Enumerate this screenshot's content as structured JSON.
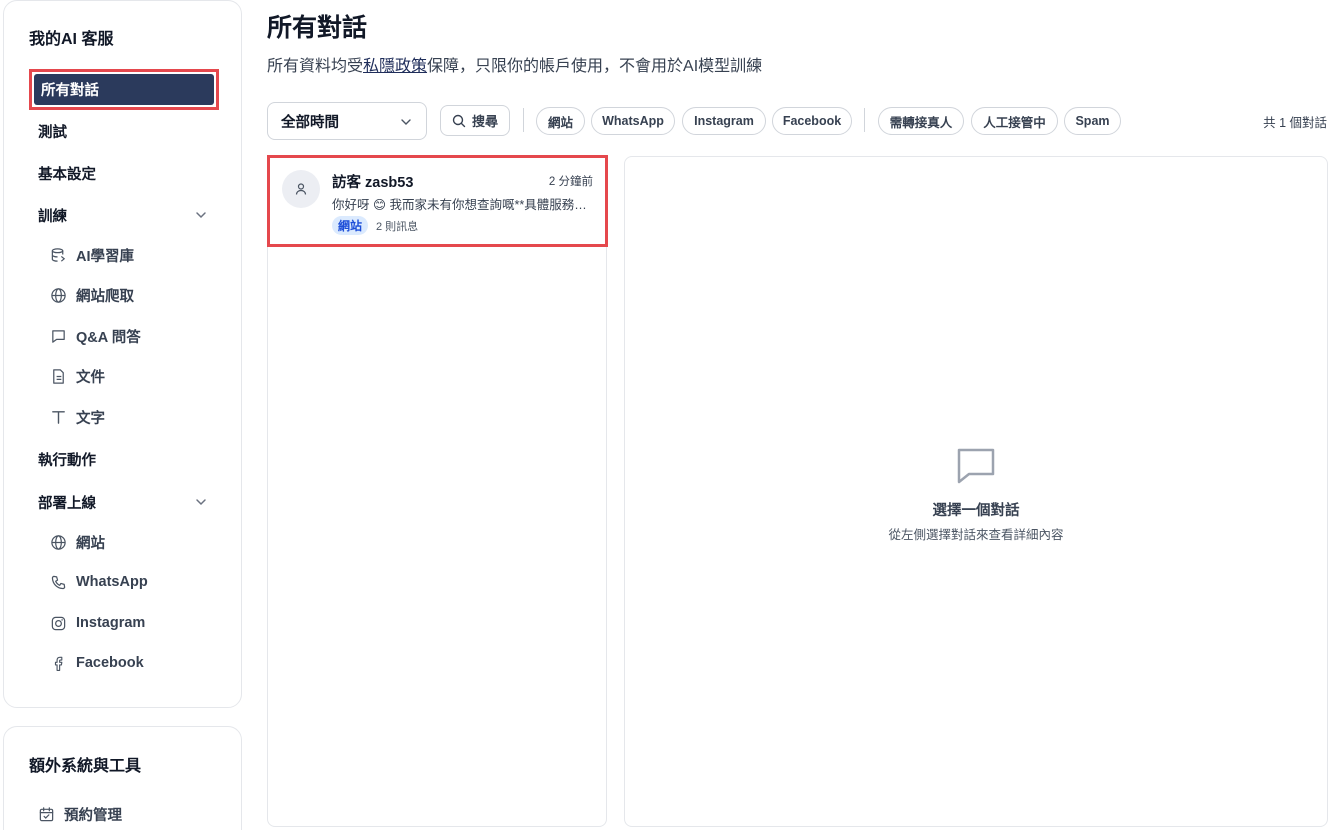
{
  "sidebar": {
    "title": "我的AI 客服",
    "active_item": "所有對話",
    "items": {
      "test": "測試",
      "basic_settings": "基本設定",
      "training": "訓練",
      "actions": "執行動作",
      "deploy": "部署上線"
    },
    "training_items": {
      "knowledge_base": "AI學習庫",
      "web_crawl": "網站爬取",
      "qa": "Q&A 問答",
      "files": "文件",
      "text": "文字"
    },
    "deploy_items": {
      "website": "網站",
      "whatsapp": "WhatsApp",
      "instagram": "Instagram",
      "facebook": "Facebook"
    }
  },
  "tools": {
    "title": "額外系統與工具",
    "booking": "預約管理"
  },
  "header": {
    "title": "所有對話",
    "subtitle_before": "所有資料均受",
    "privacy_link": "私隱政策",
    "subtitle_after": "保障，只限你的帳戶使用，不會用於AI模型訓練"
  },
  "filters": {
    "time_select": "全部時間",
    "search_label": "搜尋",
    "channels": {
      "website": "網站",
      "whatsapp": "WhatsApp",
      "instagram": "Instagram",
      "facebook": "Facebook"
    },
    "statuses": {
      "needs_human": "需轉接真人",
      "human_takeover": "人工接管中",
      "spam": "Spam"
    },
    "total": "共 1 個對話"
  },
  "conversations": [
    {
      "name": "訪客 zasb53",
      "time": "2 分鐘前",
      "preview": "你好呀 😊 我而家未有你想查詢嘅**具體服務資料**，可以講多少少你想了解嘅內容嗎？",
      "tag": "網站",
      "message_count": "2 則訊息"
    }
  ],
  "empty_state": {
    "title": "選擇一個對話",
    "subtitle": "從左側選擇對話來查看詳細內容"
  },
  "colors": {
    "active_nav_bg": "#2b3a5c",
    "highlight_border": "#e5484d",
    "tag_bg": "#dbeafe",
    "tag_text": "#1d4ed8"
  }
}
